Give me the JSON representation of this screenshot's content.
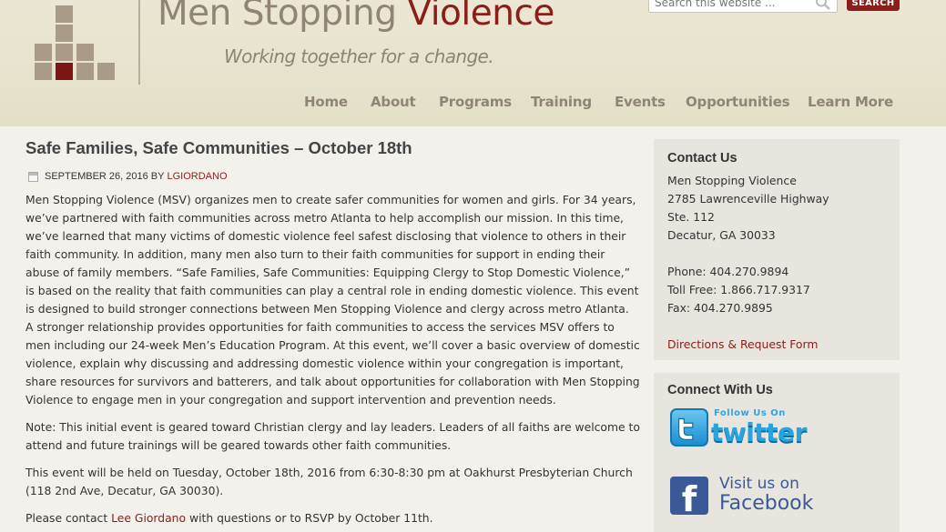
{
  "header": {
    "site_title_main": "Men Stopping ",
    "site_title_accent": "Violence",
    "tagline": "Working together for a change.",
    "search_placeholder": "Search this website ...",
    "search_button": "SEARCH"
  },
  "nav": {
    "items": [
      {
        "label": "Home"
      },
      {
        "label": "About"
      },
      {
        "label": "Programs"
      },
      {
        "label": "Training"
      },
      {
        "label": "Events"
      },
      {
        "label": "Opportunities"
      },
      {
        "label": "Learn More"
      }
    ]
  },
  "post": {
    "title": "Safe Families, Safe Communities – October 18th",
    "date": "SEPTEMBER 26, 2016",
    "by": "BY",
    "author": "LGIORDANO",
    "paragraph1": "Men Stopping Violence (MSV) organizes men to create safer communities for women and girls. For 34 years, we’ve partnered with faith communities across metro Atlanta to help accomplish our mission. In this time, we’ve learned that many victims of domestic violence feel safest disclosing that violence to others in their faith community. In addition, many men also turn to their faith communities for support in ending their abuse of family members. “Safe Families, Safe Communities: Equipping Clergy to Stop Domestic Violence,” is based on the reality that faith communities can play a central role in ending domestic violence. This event is designed to build stronger connections between Men Stopping Violence and clergy across metro Atlanta. A stronger relationship provides opportunities for faith communities to access the services MSV offers to men including our 24-week Men’s Education Program. At this event, we’ll cover a basic overview of domestic violence, explain why discussing and addressing domestic violence within your congregation is important, share resources for survivors and batterers, and talk about opportunities for collaboration with Men Stopping Violence to engage men in your congregation and support intervention and prevention needs.",
    "paragraph2": "Note: This initial event is geared toward Christian clergy and lay leaders.  Leaders of all faiths are welcome to attend and future trainings will be geared towards other faith communities.",
    "paragraph3": "This event will be held on Tuesday, October 18th, 2016 from 6:30-8:30 pm at Oakhurst Presbyterian Church (118 2nd Ave, Decatur, GA 30030).",
    "paragraph4_pre": "Please contact ",
    "paragraph4_link": "Lee Giordano",
    "paragraph4_post": " with questions or to RSVP by October 11th."
  },
  "sidebar": {
    "contact": {
      "title": "Contact Us",
      "org": "Men Stopping Violence",
      "street": "2785 Lawrenceville Highway",
      "suite": "Ste. 112",
      "city": "Decatur, GA 30033",
      "phone": "Phone: 404.270.9894",
      "tollfree": "Toll Free: 1.866.717.9317",
      "fax": "Fax: 404.270.9895",
      "directions_link": "Directions & Request Form"
    },
    "connect": {
      "title": "Connect With Us",
      "twitter_follow": "Follow Us On",
      "twitter_word": "twitter",
      "facebook_visit": "Visit us on",
      "facebook_word": "Facebook",
      "facebook_glyph": "f"
    }
  }
}
